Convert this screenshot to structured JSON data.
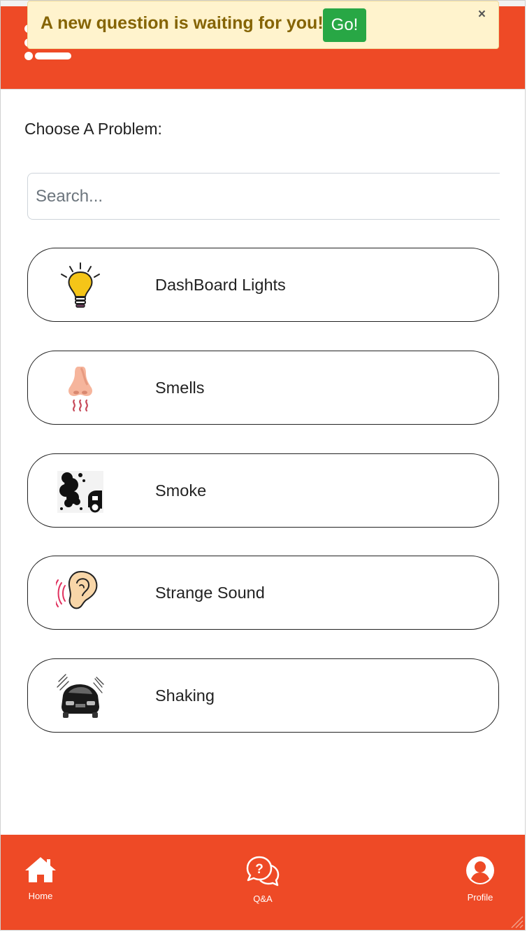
{
  "alert": {
    "message": "A new question is waiting for you!",
    "go_label": "Go!",
    "close_label": "×"
  },
  "main": {
    "prompt": "Choose A Problem:",
    "search": {
      "placeholder": "Search...",
      "value": ""
    },
    "problems": [
      {
        "label": "DashBoard Lights",
        "icon": "light-bulb-icon"
      },
      {
        "label": "Smells",
        "icon": "nose-icon"
      },
      {
        "label": "Smoke",
        "icon": "smoke-icon"
      },
      {
        "label": "Strange Sound",
        "icon": "ear-icon"
      },
      {
        "label": "Shaking",
        "icon": "shaking-car-icon"
      }
    ]
  },
  "footer": {
    "nav": [
      {
        "label": "Home",
        "icon": "home-icon"
      },
      {
        "label": "Q&A",
        "icon": "qa-chat-icon"
      },
      {
        "label": "Profile",
        "icon": "profile-icon"
      }
    ]
  },
  "colors": {
    "brand": "#ee4a26",
    "alert_bg": "#fff3cd",
    "alert_text": "#856404",
    "go_button": "#28a745"
  }
}
